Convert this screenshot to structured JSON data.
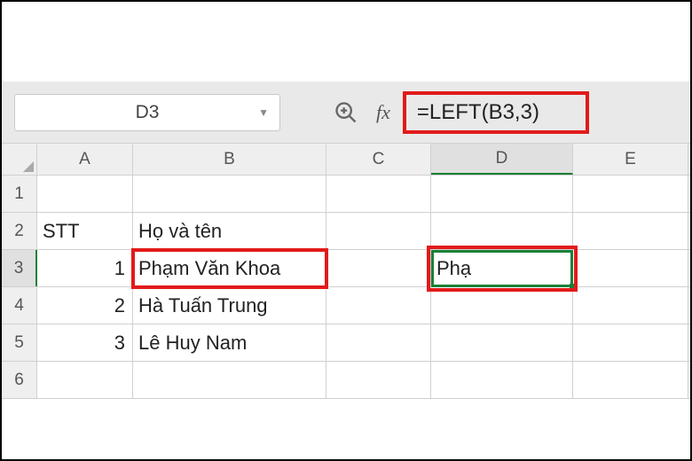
{
  "nameBox": "D3",
  "formula": "=LEFT(B3,3)",
  "columns": [
    "A",
    "B",
    "C",
    "D",
    "E"
  ],
  "rows": [
    "1",
    "2",
    "3",
    "4",
    "5",
    "6"
  ],
  "cells": {
    "A2": "STT",
    "B2": "Họ và tên",
    "A3": "1",
    "B3": "Phạm Văn Khoa",
    "D3": "Phạ",
    "A4": "2",
    "B4": "Hà Tuấn Trung",
    "A5": "3",
    "B5": "Lê Huy Nam"
  }
}
